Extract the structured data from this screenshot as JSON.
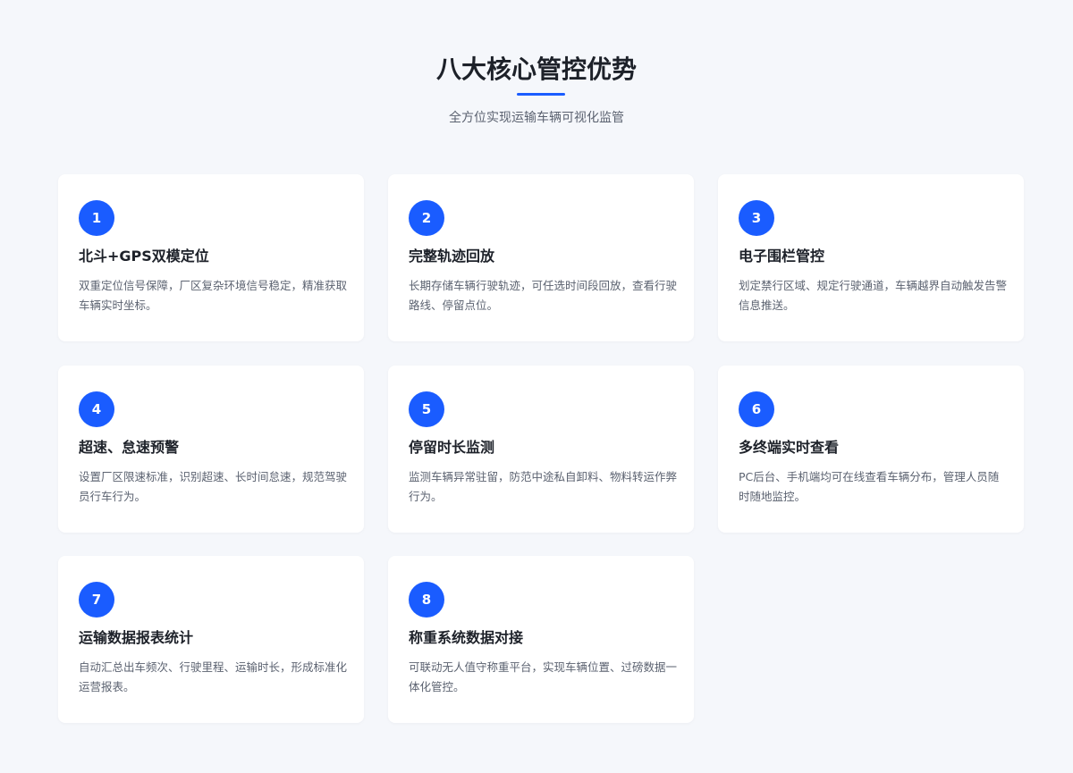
{
  "header": {
    "title": "八大核心管控优势",
    "subtitle": "全方位实现运输车辆可视化监管"
  },
  "colors": {
    "accent": "#1a5cff",
    "background": "#f5f7fb",
    "card": "#ffffff",
    "title_text": "#1d2129",
    "body_text": "#5b6270"
  },
  "features": [
    {
      "number": "1",
      "title": "北斗+GPS双模定位",
      "description": "双重定位信号保障，厂区复杂环境信号稳定，精准获取车辆实时坐标。"
    },
    {
      "number": "2",
      "title": "完整轨迹回放",
      "description": "长期存储车辆行驶轨迹，可任选时间段回放，查看行驶路线、停留点位。"
    },
    {
      "number": "3",
      "title": "电子围栏管控",
      "description": "划定禁行区域、规定行驶通道，车辆越界自动触发告警信息推送。"
    },
    {
      "number": "4",
      "title": "超速、怠速预警",
      "description": "设置厂区限速标准，识别超速、长时间怠速，规范驾驶员行车行为。"
    },
    {
      "number": "5",
      "title": "停留时长监测",
      "description": "监测车辆异常驻留，防范中途私自卸料、物料转运作弊行为。"
    },
    {
      "number": "6",
      "title": "多终端实时查看",
      "description": "PC后台、手机端均可在线查看车辆分布，管理人员随时随地监控。"
    },
    {
      "number": "7",
      "title": "运输数据报表统计",
      "description": "自动汇总出车频次、行驶里程、运输时长，形成标准化运营报表。"
    },
    {
      "number": "8",
      "title": "称重系统数据对接",
      "description": "可联动无人值守称重平台，实现车辆位置、过磅数据一体化管控。"
    }
  ]
}
